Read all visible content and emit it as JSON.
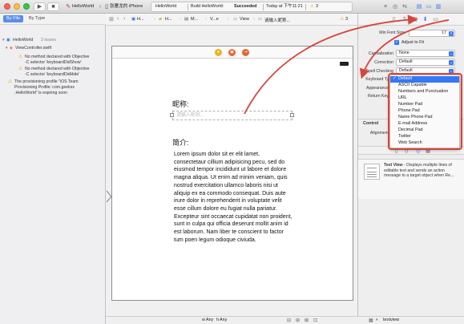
{
  "titlebar": {
    "scheme": "HelloWorld",
    "device": "张雁龙的 iPhone",
    "status_project": "HelloWorld",
    "status_prefix": "Build HelloWorld:",
    "status_result": "Succeeded",
    "status_time": "Today at 下午11:21",
    "warning_count": "3"
  },
  "navigator": {
    "tab_file": "By File",
    "tab_type": "By Type",
    "project": "HelloWorld",
    "issue_count": "3 issues",
    "file": "ViewController.swift",
    "issues": [
      {
        "line1": "No method declared with Objective",
        "line2": "-C selector 'keyboardDidShow'"
      },
      {
        "line1": "No method declared with Objective",
        "line2": "-C selector 'keyboardDidHide'"
      },
      {
        "line1": "The provisioning profile \"iOS Team",
        "line2": "Provisioning Profile: com.geekss",
        "line3": ".HelloWorld\" is expiring soon"
      }
    ]
  },
  "jumpbar": {
    "items": [
      "H...",
      "H...",
      "M...",
      "V...e",
      "View",
      "请输入昵称..."
    ],
    "warning_count": "3"
  },
  "scene": {
    "name_label": "昵称:",
    "name_placeholder": "请输入昵称...",
    "intro_label": "简介:",
    "lorem": "Lorem ipsum dolor sit er elit lamet, consectetaur cillium adipisicing pecu, sed do eiusmod tempor incididunt ut labore et dolore magna aliqua. Ut enim ad minim veniam, quis nostrud exercitation ullamco laboris nisi ut aliquip ex ea commodo consequat. Duis aute irure dolor in reprehenderit in voluptate velit esse cillum dolore eu fugiat nulla pariatur. Excepteur sint occaecat cupidatat non proident, sunt in culpa qui officia deserunt mollit anim id est laborum. Nam liber te conscient to factor tum poen legum odioque civiuda."
  },
  "bottombar": {
    "w_any": "Any",
    "h_any": "Any",
    "filter_text": "textview"
  },
  "inspector": {
    "min_font_label": "Min Font Size",
    "min_font_value": "17",
    "adjust_to_fit": "Adjust to Fit",
    "capitalization_label": "Capitalization",
    "capitalization_value": "None",
    "correction_label": "Correction",
    "correction_value": "Default",
    "spell_label": "Spell Checking",
    "spell_value": "Default",
    "keyboard_label": "Keyboard Type",
    "appearance_label": "Appearance",
    "return_label": "Return Key",
    "control_header": "Control",
    "alignment_label": "Alignment"
  },
  "dropdown": {
    "options": [
      "Default",
      "ASCII Capable",
      "Numbers and Punctuation",
      "URL",
      "Number Pad",
      "Phone Pad",
      "Name Phone Pad",
      "E-mail Address",
      "Decimal Pad",
      "Twitter",
      "Web Search"
    ],
    "selected": "Default"
  },
  "library": {
    "title": "Text View",
    "description": "Displays multiple lines of editable text and sends an action message to a target object when Re..."
  },
  "colors": {
    "accent": "#3478f6",
    "annotation": "#d9443a",
    "warning": "#e8a700"
  }
}
